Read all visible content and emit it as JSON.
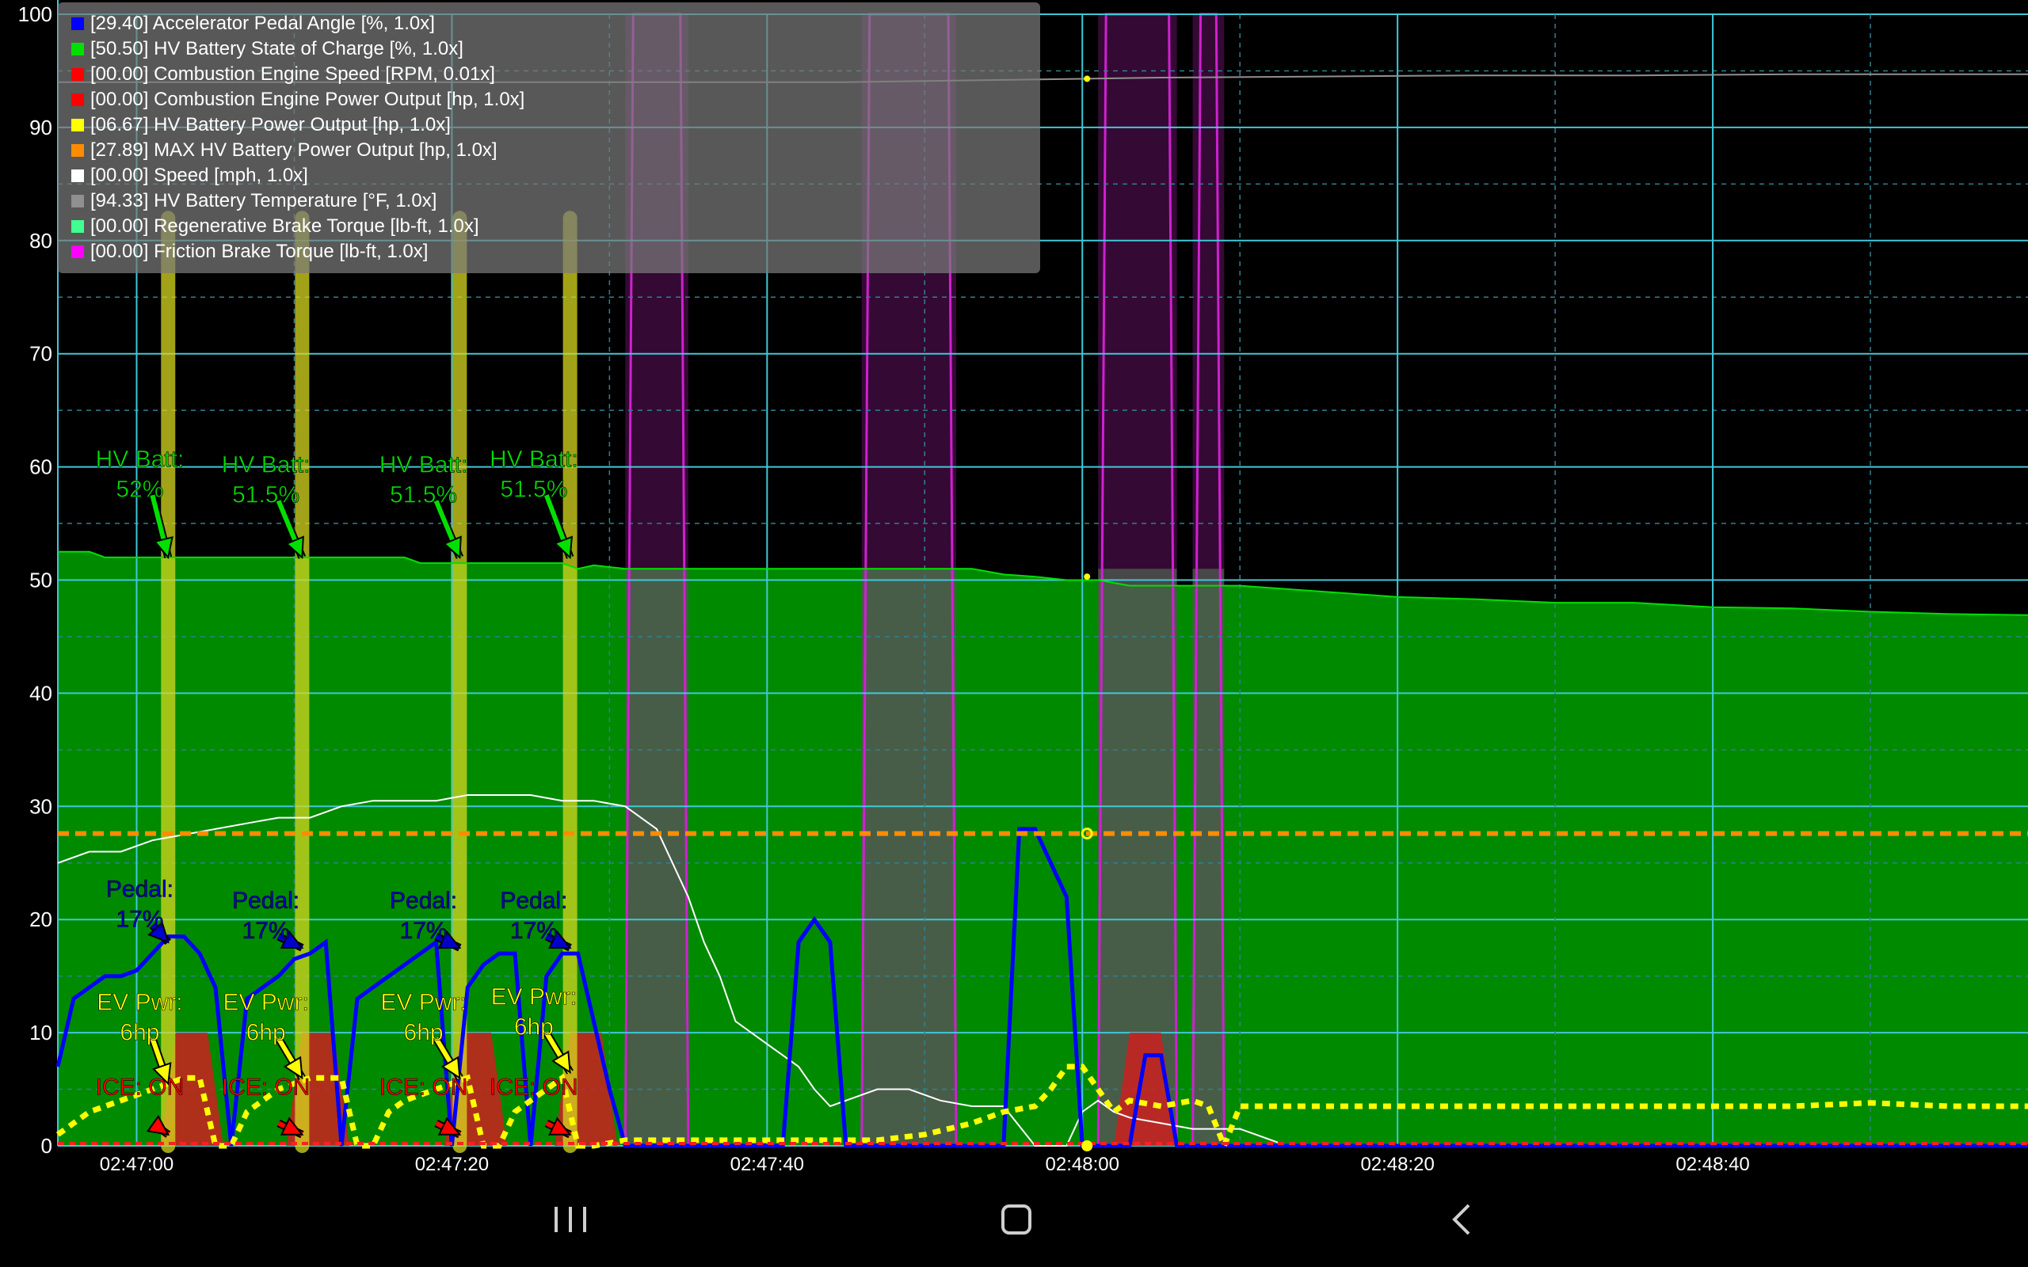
{
  "chart_data": {
    "type": "line",
    "ylim": [
      0,
      100
    ],
    "y_ticks": [
      "0",
      "10",
      "20",
      "30",
      "40",
      "50",
      "60",
      "70",
      "80",
      "90",
      "100"
    ],
    "x_tick_labels": [
      "02:47:00",
      "02:47:20",
      "02:47:40",
      "02:48:00",
      "02:48:20",
      "02:48:40"
    ],
    "x_tick_values": [
      5,
      25,
      45,
      65,
      85,
      105
    ],
    "xlim": [
      0,
      125
    ],
    "grid": true,
    "legend_position": "top-left",
    "legend": [
      {
        "label": "[29.40] Accelerator Pedal Angle [%, 1.0x]",
        "color": "#0000ff"
      },
      {
        "label": "[50.50] HV Battery State of Charge [%, 1.0x]",
        "color": "#00e000"
      },
      {
        "label": "[00.00] Combustion Engine Speed [RPM, 0.01x]",
        "color": "#ff0000"
      },
      {
        "label": "[00.00] Combustion Engine Power Output [hp, 1.0x]",
        "color": "#ff0000"
      },
      {
        "label": "[06.67] HV Battery Power Output [hp, 1.0x]",
        "color": "#ffff00"
      },
      {
        "label": "[27.89] MAX HV Battery Power Output [hp, 1.0x]",
        "color": "#ff8c00"
      },
      {
        "label": "[00.00] Speed [mph, 1.0x]",
        "color": "#ffffff"
      },
      {
        "label": "[94.33] HV Battery Temperature [°F, 1.0x]",
        "color": "#909090"
      },
      {
        "label": "[00.00] Regenerative Brake Torque [lb-ft, 1.0x]",
        "color": "#40ff90"
      },
      {
        "label": "[00.00] Friction Brake Torque [lb-ft, 1.0x]",
        "color": "#ff00ff"
      }
    ],
    "series": [
      {
        "name": "HV Battery State of Charge",
        "color": "#00e000",
        "x": [
          0,
          2,
          3,
          22,
          23,
          32,
          33,
          34,
          36,
          40,
          58,
          60,
          62,
          64,
          66,
          68,
          70,
          75,
          80,
          85,
          90,
          95,
          100,
          105,
          110,
          115,
          120,
          125
        ],
        "y": [
          52.5,
          52.5,
          52,
          52,
          51.5,
          51.5,
          51,
          51.3,
          51,
          51,
          51,
          50.5,
          50.3,
          50,
          50,
          49.5,
          49.5,
          49.5,
          49,
          48.5,
          48.3,
          48,
          48,
          47.6,
          47.5,
          47.2,
          47,
          46.9
        ]
      },
      {
        "name": "Speed",
        "color": "#ffffff",
        "x": [
          0,
          2,
          4,
          6,
          8,
          10,
          12,
          14,
          16,
          18,
          20,
          22,
          24,
          26,
          28,
          30,
          32,
          34,
          36,
          38,
          40,
          41,
          42,
          43,
          44,
          45,
          46,
          47,
          48,
          49,
          50,
          52,
          54,
          56,
          58,
          60,
          62,
          64,
          65,
          66,
          67,
          68,
          70,
          72,
          74,
          75,
          76,
          78,
          80,
          125
        ],
        "y": [
          25,
          26,
          26,
          27,
          27.5,
          28,
          28.5,
          29,
          29,
          30,
          30.5,
          30.5,
          30.5,
          31,
          31,
          31,
          30.5,
          30.5,
          30,
          28,
          22,
          18,
          15,
          11,
          10,
          9,
          8,
          7,
          5,
          3.5,
          4,
          5,
          5,
          4,
          3.5,
          3.5,
          0,
          0,
          3,
          4,
          3,
          2.5,
          2,
          1.5,
          1.5,
          1.5,
          1,
          0,
          0,
          0
        ]
      },
      {
        "name": "Accelerator Pedal Angle",
        "color": "#0000ff",
        "x": [
          0,
          1,
          2,
          3,
          4,
          5,
          6,
          7,
          8,
          9,
          10,
          11,
          12,
          13,
          14,
          15,
          16,
          17,
          18,
          19,
          20,
          21,
          22,
          23,
          24,
          25,
          26,
          27,
          28,
          29,
          30,
          31,
          32,
          33,
          34,
          35,
          36,
          37,
          38,
          46,
          47,
          48,
          49,
          50,
          51,
          52,
          60,
          61,
          62,
          63,
          64,
          65,
          66,
          67,
          68,
          69,
          70,
          71,
          72,
          125
        ],
        "y": [
          7,
          13,
          14,
          15,
          15,
          15.5,
          17,
          18.5,
          18.5,
          17,
          14,
          0,
          13,
          14,
          15,
          16.5,
          17,
          18,
          0,
          13,
          14,
          15,
          16,
          17,
          18,
          0,
          14,
          16,
          17,
          17,
          0,
          15,
          17,
          17,
          11,
          5,
          0,
          0,
          0,
          0,
          18,
          20,
          18,
          0,
          0,
          0,
          0,
          28,
          28,
          25,
          22,
          0,
          0,
          0,
          0,
          8,
          8,
          0,
          0,
          0
        ]
      },
      {
        "name": "HV Battery Power Output",
        "color": "#ffff00",
        "x": [
          0,
          2,
          4,
          6,
          8,
          9,
          10,
          11,
          12,
          13,
          14,
          16,
          18,
          19,
          20,
          21,
          22,
          24,
          26,
          27,
          28,
          29,
          30,
          31,
          32,
          33,
          34,
          36,
          40,
          44,
          48,
          52,
          55,
          58,
          60,
          62,
          63,
          64,
          65,
          66,
          67,
          68,
          70,
          72,
          73,
          74,
          75,
          76,
          80,
          90,
          100,
          110,
          115,
          120,
          125
        ],
        "y": [
          1,
          3,
          4,
          5,
          6,
          6,
          0,
          0,
          3,
          4,
          5,
          6,
          6,
          0,
          0,
          3,
          4,
          5,
          6,
          0,
          0,
          3,
          4,
          5,
          6,
          0,
          0,
          0.5,
          0.5,
          0.5,
          0.5,
          0.5,
          1,
          2,
          3,
          3.5,
          5,
          7,
          7,
          5,
          3,
          4,
          3.5,
          4,
          3.5,
          0,
          3.5,
          3.5,
          3.5,
          3.5,
          3.5,
          3.5,
          3.8,
          3.5,
          3.5
        ]
      },
      {
        "name": "MAX HV Battery Power Output",
        "color": "#ff8c00",
        "x": [
          0,
          125
        ],
        "y": [
          27.6,
          27.6
        ]
      },
      {
        "name": "HV Battery Temperature",
        "color": "#909090",
        "x": [
          0,
          10,
          20,
          30,
          40,
          50,
          60,
          65,
          70,
          80,
          90,
          100,
          110,
          120,
          125
        ],
        "y": [
          94,
          94,
          94,
          94,
          94,
          94,
          94.2,
          94.3,
          94.4,
          94.5,
          94.6,
          94.6,
          94.7,
          94.7,
          94.7
        ]
      }
    ],
    "pulses": {
      "yellow_bars_x": [
        7,
        15.5,
        25.5,
        32.5
      ],
      "ice_on_humps_x": [
        8.5,
        16.5,
        26.5,
        33.5,
        69
      ],
      "friction_brake_windows": [
        [
          36,
          40
        ],
        [
          51,
          57
        ],
        [
          66,
          71
        ],
        [
          72,
          74
        ]
      ]
    },
    "annotations": [
      {
        "text_line1": "HV Batt:",
        "text_line2": "52%",
        "color": "#00e000"
      },
      {
        "text_line1": "HV Batt:",
        "text_line2": "51.5%",
        "color": "#00e000"
      },
      {
        "text_line1": "HV Batt:",
        "text_line2": "51.5%",
        "color": "#00e000"
      },
      {
        "text_line1": "HV Batt:",
        "text_line2": "51.5%",
        "color": "#00e000"
      },
      {
        "text_line1": "Pedal:",
        "text_line2": "17%",
        "color": "#0000cc"
      },
      {
        "text_line1": "Pedal:",
        "text_line2": "17%",
        "color": "#0000cc"
      },
      {
        "text_line1": "Pedal:",
        "text_line2": "17%",
        "color": "#0000cc"
      },
      {
        "text_line1": "Pedal:",
        "text_line2": "17%",
        "color": "#0000cc"
      },
      {
        "text_line1": "EV Pwr:",
        "text_line2": "6hp",
        "color": "#ffff00"
      },
      {
        "text_line1": "EV Pwr:",
        "text_line2": "6hp",
        "color": "#ffff00"
      },
      {
        "text_line1": "EV Pwr:",
        "text_line2": "6hp",
        "color": "#ffff00"
      },
      {
        "text_line1": "EV Pwr:",
        "text_line2": "6hp",
        "color": "#ffff00"
      },
      {
        "text_line1": "ICE: ON",
        "text_line2": "",
        "color": "#ff0000"
      },
      {
        "text_line1": "ICE: ON",
        "text_line2": "",
        "color": "#ff0000"
      },
      {
        "text_line1": "ICE: ON",
        "text_line2": "",
        "color": "#ff0000"
      },
      {
        "text_line1": "ICE: ON",
        "text_line2": "",
        "color": "#ff0000"
      }
    ]
  },
  "navbar": {
    "recent_icon": "recent-apps-icon",
    "home_icon": "home-icon",
    "back_icon": "back-icon"
  }
}
